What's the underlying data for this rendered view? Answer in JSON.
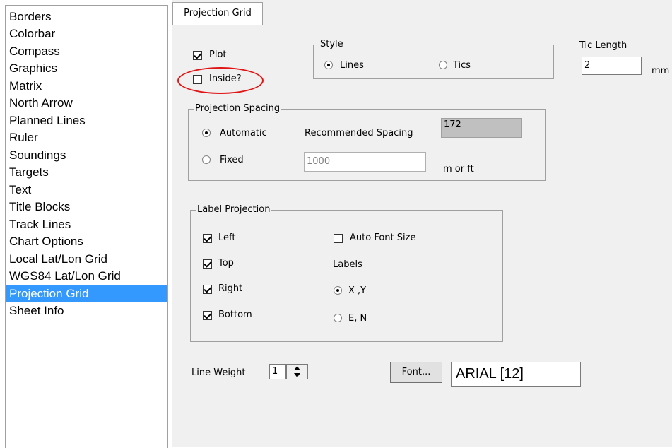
{
  "nav": {
    "items": [
      "Borders",
      "Colorbar",
      "Compass",
      "Graphics",
      "Matrix",
      "North Arrow",
      "Planned Lines",
      "Ruler",
      "Soundings",
      "Targets",
      "Text",
      "Title Blocks",
      "Track Lines",
      "Chart Options",
      "Local Lat/Lon Grid",
      "WGS84 Lat/Lon Grid",
      "Projection Grid",
      "Sheet Info"
    ],
    "selected": "Projection Grid"
  },
  "tab": {
    "label": "Projection Grid"
  },
  "plot": {
    "label": "Plot",
    "checked": true
  },
  "inside": {
    "label": "Inside?",
    "checked": false
  },
  "style": {
    "title": "Style",
    "lines": "Lines",
    "tics": "Tics",
    "selected": "Lines"
  },
  "tic_length": {
    "label": "Tic Length",
    "value": "2",
    "unit": "mm"
  },
  "spacing": {
    "title": "Projection Spacing",
    "automatic": "Automatic",
    "fixed": "Fixed",
    "recommended_label": "Recommended Spacing",
    "recommended_value": "172",
    "fixed_value": "1000",
    "unit": "m or ft",
    "selected": "Automatic"
  },
  "label_projection": {
    "title": "Label Projection",
    "left": "Left",
    "top": "Top",
    "right": "Right",
    "bottom": "Bottom",
    "auto_font": "Auto Font Size",
    "labels": "Labels",
    "xy": "X ,Y",
    "en": "E, N",
    "selected": "X ,Y"
  },
  "line_weight": {
    "label": "Line Weight",
    "value": "1"
  },
  "font": {
    "button": "Font...",
    "value": "ARIAL [12]"
  },
  "colors": {
    "selection": "#3399ff",
    "annotation": "#e01515"
  }
}
